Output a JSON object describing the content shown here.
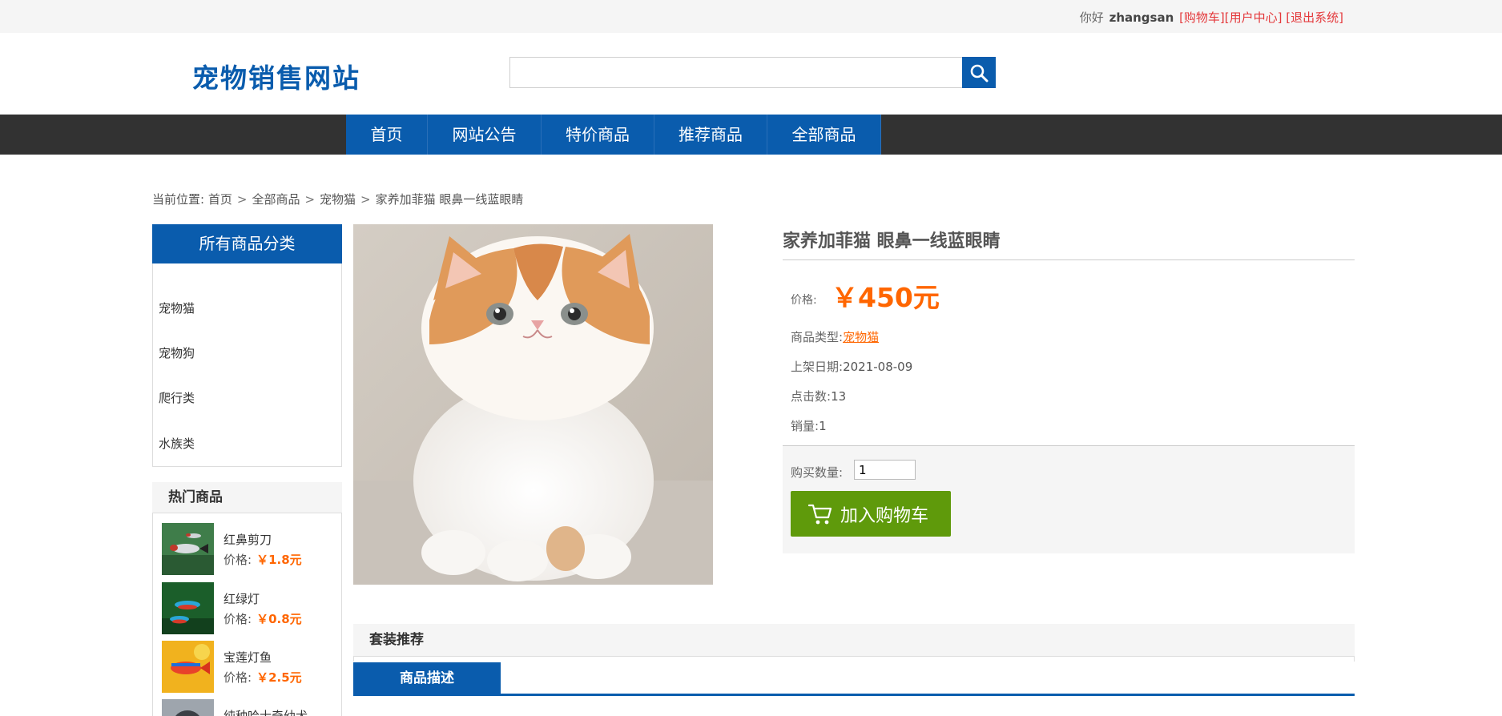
{
  "topbar": {
    "greeting": "你好",
    "username": "zhangsan",
    "cart_link": "[购物车]",
    "user_center_link": "[用户中心]",
    "logout_link": "[退出系统]"
  },
  "header": {
    "logo": "宠物销售网站",
    "search": {
      "value": "",
      "placeholder": ""
    }
  },
  "nav": {
    "items": [
      "首页",
      "网站公告",
      "特价商品",
      "推荐商品",
      "全部商品"
    ]
  },
  "breadcrumb": {
    "prefix": "当前位置:",
    "items": [
      "首页",
      "全部商品",
      "宠物猫",
      "家养加菲猫 眼鼻一线蓝眼睛"
    ]
  },
  "categories": {
    "title": "所有商品分类",
    "items": [
      "宠物猫",
      "宠物狗",
      "爬行类",
      "水族类"
    ]
  },
  "hot": {
    "title": "热门商品",
    "price_label": "价格:",
    "items": [
      {
        "name": "红鼻剪刀",
        "price": "￥1.8元"
      },
      {
        "name": "红绿灯",
        "price": "￥0.8元"
      },
      {
        "name": "宝莲灯鱼",
        "price": "￥2.5元"
      },
      {
        "name": "纯种哈士奇幼犬",
        "price": ""
      }
    ]
  },
  "product": {
    "title": "家养加菲猫 眼鼻一线蓝眼睛",
    "price_label": "价格:",
    "price": "￥450元",
    "type_label": "商品类型:",
    "type_value": "宠物猫",
    "date_label": "上架日期:",
    "date_value": "2021-08-09",
    "clicks_label": "点击数:",
    "clicks_value": "13",
    "sales_label": "销量:",
    "sales_value": "1",
    "qty_label": "购买数量:",
    "qty_value": "1",
    "cart_button": "加入购物车"
  },
  "bundle": {
    "title": "套装推荐"
  },
  "tabs": {
    "description": "商品描述"
  },
  "colors": {
    "brand_blue": "#0a5cad",
    "price_orange": "#ff6600",
    "cart_green": "#5f9a0b",
    "link_red": "#e4393c",
    "nav_dark": "#323232"
  },
  "icons": {
    "search": "magnifier-icon",
    "cart": "shopping-cart-icon"
  }
}
